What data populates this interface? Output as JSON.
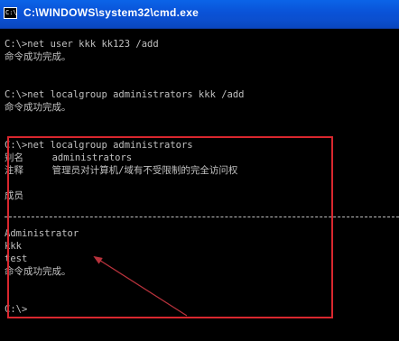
{
  "window": {
    "title": "C:\\WINDOWS\\system32\\cmd.exe",
    "icon_text": "C:\\"
  },
  "console": {
    "lines": [
      "C:\\>net user kkk kk123 /add",
      "命令成功完成。",
      "",
      "",
      "C:\\>net localgroup administrators kkk /add",
      "命令成功完成。",
      "",
      "",
      "C:\\>net localgroup administrators",
      "别名     administrators",
      "注释     管理员对计算机/域有不受限制的完全访问权",
      "",
      "成员",
      "",
      "-------------------------------------------------------------------------------",
      "Administrator",
      "kkk",
      "test",
      "命令成功完成。",
      "",
      "",
      "C:\\>"
    ]
  },
  "annotation": {
    "box_color": "#d9272e",
    "arrow_color": "#b8323c"
  }
}
